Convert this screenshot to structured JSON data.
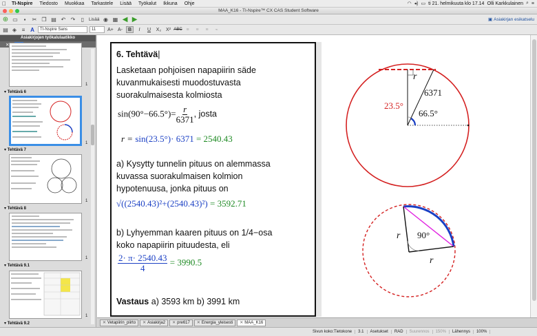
{
  "menubar": {
    "app_name": "TI-Nspire",
    "items": [
      "Tiedosto",
      "Muokkaa",
      "Tarkastele",
      "Lisää",
      "Työkalut",
      "Ikkuna",
      "Ohje"
    ],
    "clock": "ti 21. helmikuuta klo 17.14",
    "user": "Olli Karkkulainen"
  },
  "window": {
    "title": "MAA_K16 - TI-Nspire™ CX CAS Student Software"
  },
  "toolbar": {
    "insert_label": "Lisää",
    "workspace_label": "Asiakirjan esikatselu"
  },
  "format_bar": {
    "font_name": "TI-Nspire Sans",
    "font_size": "11",
    "bold_label": "B",
    "italic_label": "I",
    "underline_label": "U",
    "sub_label": "X₂",
    "sup_label": "X²",
    "strike_label": "ABC"
  },
  "sidebar": {
    "title": "Asiakirjojen työkalulaatikko",
    "sections": [
      {
        "label": "Tehtävä 6",
        "page": "1"
      },
      {
        "label": "Tehtävä 7",
        "page": "1"
      },
      {
        "label": "Tehtävä 8",
        "page": "1"
      },
      {
        "label": "Tehtävä 9.1",
        "page": "1"
      },
      {
        "label": "Tehtävä 9.2",
        "page": ""
      }
    ],
    "first_page_num": "1"
  },
  "document": {
    "heading": "6. Tehtävä",
    "intro_lines": [
      "Lasketaan pohjoisen napapiirin säde",
      "kuvanmukaisesti muodostuvasta",
      "suorakulmaisesta kolmiosta"
    ],
    "eq1_left": "sin(90°−66.5°)=",
    "eq1_num": "r",
    "eq1_den": "6371",
    "eq1_tail": ", josta",
    "eq2_var": "r = ",
    "eq2_expr": "sin(23.5°)· 6371",
    "eq2_result": "= 2540.43",
    "part_a_lines": [
      "a) Kysytty tunnelin pituus on alemmassa",
      "kuvassa suorakulmaisen kolmion",
      "hypotenuusa, jonka pituus on"
    ],
    "eq3_expr": "√((2540.43)²+(2540.43)²)",
    "eq3_result": "= 3592.71",
    "part_b_lines": [
      "b) Lyhyemman kaaren pituus on 1/4−osa",
      "koko napapiirin pituudesta, eli"
    ],
    "eq4_num": "2· π· 2540.43",
    "eq4_den": "4",
    "eq4_result": "= 3990.5",
    "answer_label": "Vastaus",
    "answer_text": " a) 3593 km b) 3991 km"
  },
  "figure1": {
    "label_r": "r",
    "label_radius": "6371",
    "label_angle_outer": "23.5°",
    "label_angle_inner": "66.5°",
    "circle_color": "#d42020",
    "angle_color": "#1a3fc4"
  },
  "figure2": {
    "label_r_left": "r",
    "label_r_bottom": "r",
    "label_angle": "90°",
    "arc_color": "#1a3fc4",
    "chord_color": "#e020e0",
    "dashed_color": "#d42020"
  },
  "tabs": [
    {
      "label": "Vetapiirin_piirto",
      "active": false
    },
    {
      "label": "Asiakirja2",
      "active": false
    },
    {
      "label": "pre617",
      "active": false
    },
    {
      "label": "Energia_yleisesti",
      "active": false
    },
    {
      "label": "MAA_K16",
      "active": true
    }
  ],
  "status": {
    "page_size": "Sivun koko:Tietokone",
    "page_num": "3.1",
    "settings": "Asetukset",
    "mode": "RAD",
    "zoom_label": "Suurennos",
    "zoom_value": "150%",
    "zoom2_label": "Lähennys",
    "zoom2_value": "100%"
  }
}
